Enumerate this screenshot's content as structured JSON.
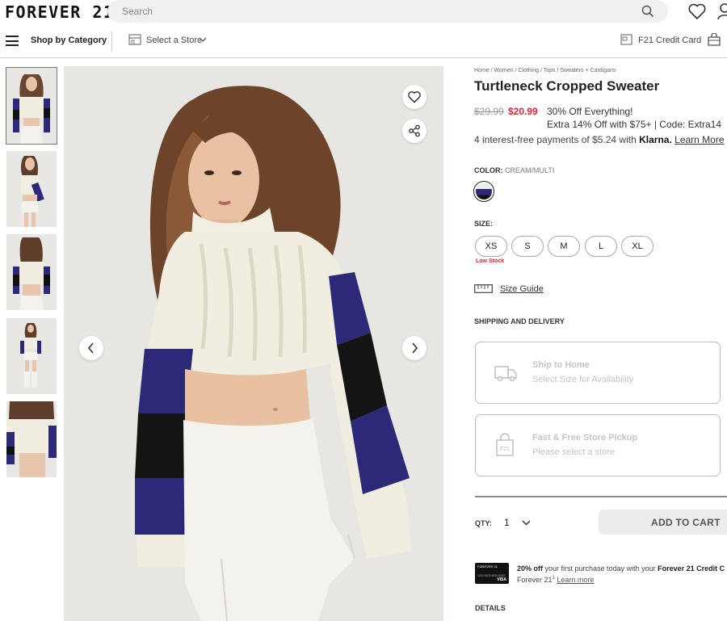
{
  "header": {
    "logo": "FOREVER 21",
    "search_placeholder": "Search"
  },
  "nav": {
    "shop_by_category": "Shop by Category",
    "select_store": "Select a Store",
    "credit_card": "F21 Credit Card"
  },
  "product": {
    "breadcrumb": "Home / Women / Clothing / Tops / Sweaters + Cardigans",
    "title": "Turtleneck Cropped Sweater",
    "price_original": "$29.99",
    "price_sale": "$20.99",
    "promo_line1": "30% Off Everything!",
    "promo_line2": "Extra 14% Off with $75+ | Code: Extra14",
    "klarna_text": "4 interest-free payments of $5.24 with",
    "klarna_brand": "Klarna.",
    "klarna_link": "Learn More",
    "color_label": "COLOR:",
    "color_value": "CREAM/MULTI",
    "size_label": "SIZE:",
    "sizes": [
      "XS",
      "S",
      "M",
      "L",
      "XL"
    ],
    "low_stock": "Low Stock",
    "size_guide": "Size Guide",
    "shipping_label": "SHIPPING AND DELIVERY",
    "ship_home_title": "Ship to Home",
    "ship_home_sub": "Select Size for Availability",
    "pickup_title": "Fast & Free Store Pickup",
    "pickup_sub": "Please select a store",
    "qty_label": "QTY:",
    "qty_value": "1",
    "add_to_cart": "ADD TO CART",
    "credit_offer_pct": "20% off",
    "credit_offer_mid": "your first purchase today with your",
    "credit_offer_brand": "Forever 21 Credit C",
    "credit_offer_line2": "Forever 21",
    "credit_offer_sup": "1",
    "credit_offer_link": "Learn more",
    "card_brand": "FOREVER 21",
    "card_number": "1234 5678 9876 5432",
    "card_network": "VISA",
    "details_label": "DETAILS"
  },
  "colors": {
    "sale_red": "#d9263a",
    "stripe_navy": "#2c2a78",
    "cream": "#f1ede1"
  },
  "icons": [
    "search-icon",
    "heart-icon",
    "user-icon",
    "menu-icon",
    "store-icon",
    "chevron-down-icon",
    "credit-card-icon",
    "bag-icon",
    "share-icon",
    "chevron-left-icon",
    "chevron-right-icon",
    "ruler-icon",
    "truck-icon",
    "shopping-bag-icon"
  ]
}
